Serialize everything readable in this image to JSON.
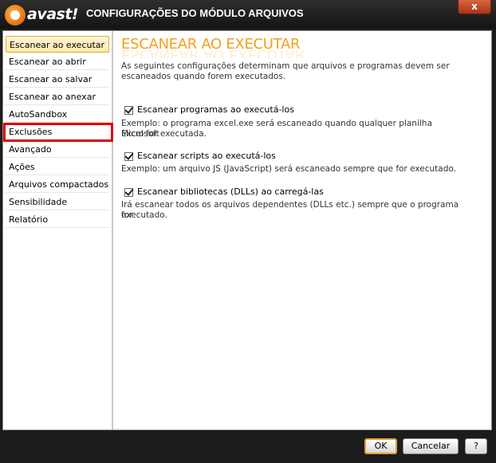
{
  "window": {
    "brand": "avast!",
    "title": "CONFIGURAÇÕES DO MÓDULO ARQUIVOS",
    "close_label": "x"
  },
  "sidebar": {
    "items": [
      {
        "label": "Escanear ao executar",
        "active": true
      },
      {
        "label": "Escanear ao abrir"
      },
      {
        "label": "Escanear ao salvar"
      },
      {
        "label": "Escanear ao anexar"
      },
      {
        "label": "AutoSandbox"
      },
      {
        "label": "Exclusões",
        "highlighted": true
      },
      {
        "label": "Avançado"
      },
      {
        "label": "Ações"
      },
      {
        "label": "Arquivos compactados"
      },
      {
        "label": "Sensibilidade"
      },
      {
        "label": "Relatório"
      }
    ]
  },
  "main": {
    "heading": "ESCANEAR AO EXECUTAR",
    "intro_line1": "As seguintes configurações determinam que arquivos e programas devem ser",
    "intro_line2": "escaneados quando forem executados.",
    "options": [
      {
        "label": "Escanear programas ao executá-los",
        "checked": true,
        "desc_line1": "Exemplo: o programa excel.exe será escaneado quando qualquer planilha Microsoft",
        "desc_line2": "Excel for executada."
      },
      {
        "label": "Escanear scripts ao executá-los",
        "checked": true,
        "desc_line1": "Exemplo: um arquivo JS (JavaScript) será escaneado sempre que for executado."
      },
      {
        "label": "Escanear bibliotecas (DLLs) ao carregá-las",
        "checked": true,
        "desc_line1": "Irá escanear todos os arquivos dependentes (DLLs etc.) sempre que o programa for",
        "desc_line2": "executado."
      }
    ]
  },
  "footer": {
    "ok_label": "OK",
    "cancel_label": "Cancelar",
    "help_label": "?"
  },
  "colors": {
    "accent": "#f0a020",
    "highlight_border": "#e00000",
    "titlebar": "#1c1c1c"
  }
}
